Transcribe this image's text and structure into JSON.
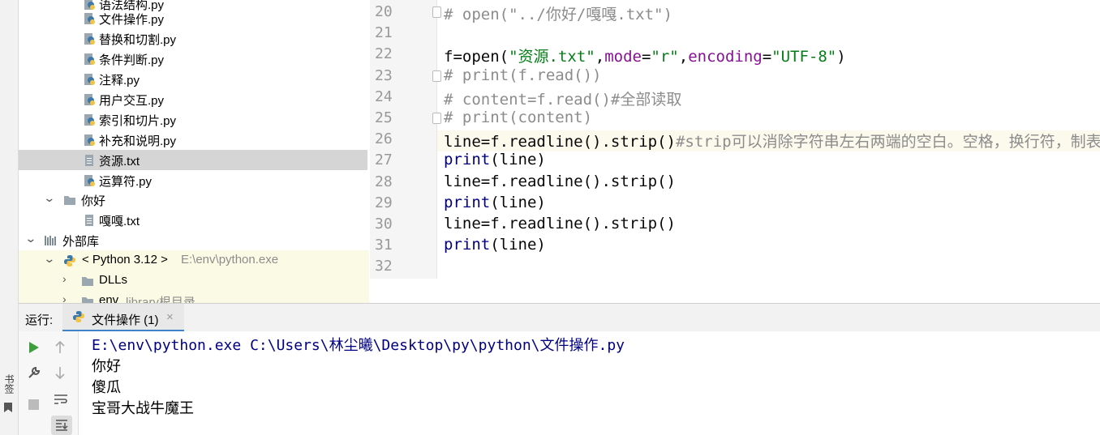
{
  "left_strip": {
    "bookmark_label": "书签"
  },
  "tree": {
    "items": [
      {
        "label": "语法结构.py",
        "type": "py"
      },
      {
        "label": "文件操作.py",
        "type": "py"
      },
      {
        "label": "替换和切割.py",
        "type": "py"
      },
      {
        "label": "条件判断.py",
        "type": "py"
      },
      {
        "label": "注释.py",
        "type": "py"
      },
      {
        "label": "用户交互.py",
        "type": "py"
      },
      {
        "label": "索引和切片.py",
        "type": "py"
      },
      {
        "label": "补充和说明.py",
        "type": "py"
      },
      {
        "label": "资源.txt",
        "type": "txt",
        "selected": true
      },
      {
        "label": "运算符.py",
        "type": "py"
      },
      {
        "label": "你好",
        "type": "folder"
      },
      {
        "label": "嘎嘎.txt",
        "type": "txt"
      },
      {
        "label": "外部库",
        "type": "library"
      },
      {
        "label": "< Python 3.12 >",
        "hint": "E:\\env\\python.exe",
        "type": "python"
      },
      {
        "label": "DLLs",
        "type": "folder"
      },
      {
        "label": "env",
        "hint": "library根目录",
        "type": "folder"
      }
    ]
  },
  "editor": {
    "line_numbers": [
      "20",
      "21",
      "22",
      "23",
      "24",
      "25",
      "26",
      "27",
      "28",
      "29",
      "30",
      "31",
      "32"
    ],
    "current_line": "26",
    "lines": [
      [
        {
          "t": "# open(\"../你好/嘎嘎.txt\")",
          "c": "cm"
        }
      ],
      [],
      [
        {
          "t": "f=",
          "c": ""
        },
        {
          "t": "open",
          "c": ""
        },
        {
          "t": "(",
          "c": ""
        },
        {
          "t": "\"资源.txt\"",
          "c": "str"
        },
        {
          "t": ",",
          "c": ""
        },
        {
          "t": "mode",
          "c": "kw"
        },
        {
          "t": "=",
          "c": ""
        },
        {
          "t": "\"r\"",
          "c": "str"
        },
        {
          "t": ",",
          "c": ""
        },
        {
          "t": "encoding",
          "c": "kw"
        },
        {
          "t": "=",
          "c": ""
        },
        {
          "t": "\"UTF-8\"",
          "c": "str"
        },
        {
          "t": ")",
          "c": ""
        }
      ],
      [
        {
          "t": "# print(f.read())",
          "c": "cm"
        }
      ],
      [
        {
          "t": "# content=f.read()#全部读取",
          "c": "cm"
        }
      ],
      [
        {
          "t": "# print(content)",
          "c": "cm"
        }
      ],
      [
        {
          "t": "line=f.readline().strip()",
          "c": ""
        },
        {
          "t": "#strip可以消除字符串左右两端的空白。空格，换行符，制表符",
          "c": "cm"
        }
      ],
      [
        {
          "t": "print",
          "c": "fn"
        },
        {
          "t": "(line)",
          "c": ""
        }
      ],
      [
        {
          "t": "line=f.readline().strip()",
          "c": ""
        }
      ],
      [
        {
          "t": "print",
          "c": "fn"
        },
        {
          "t": "(line)",
          "c": ""
        }
      ],
      [
        {
          "t": "line=f.readline().strip()",
          "c": ""
        }
      ],
      [
        {
          "t": "print",
          "c": "fn"
        },
        {
          "t": "(line)",
          "c": ""
        }
      ],
      []
    ]
  },
  "run": {
    "title": "运行:",
    "tab_label": "文件操作 (1)",
    "tab_close": "×",
    "command": "E:\\env\\python.exe C:\\Users\\林尘曦\\Desktop\\py\\python\\文件操作.py",
    "output": [
      "你好",
      "傻瓜",
      "宝哥大战牛魔王"
    ]
  },
  "colors": {
    "comment": "#8c8c8c",
    "string": "#067d17",
    "keyword_arg": "#871094",
    "builtin": "#000080",
    "selection": "#d5d5d5",
    "accent": "#4083c9"
  }
}
